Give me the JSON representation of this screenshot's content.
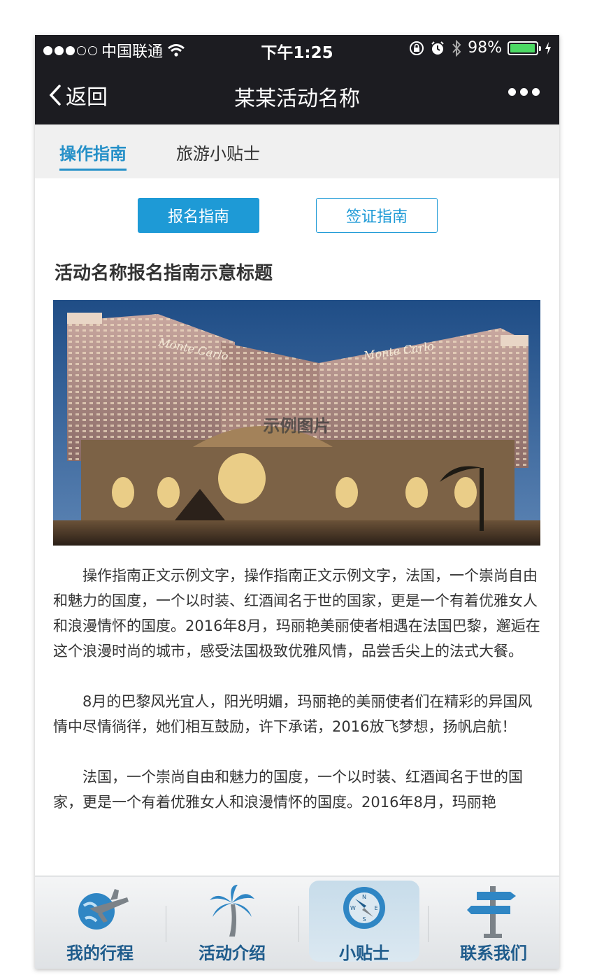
{
  "status_bar": {
    "carrier": "中国联通",
    "time": "下午1:25",
    "battery": "98%",
    "battery_level": 0.98,
    "signal_bars_filled": 3,
    "signal_bars_total": 5
  },
  "nav": {
    "back_label": "返回",
    "title": "某某活动名称"
  },
  "tabs": [
    {
      "label": "操作指南",
      "active": true
    },
    {
      "label": "旅游小贴士",
      "active": false
    }
  ],
  "sub_buttons": {
    "primary": "报名指南",
    "secondary": "签证指南"
  },
  "article": {
    "title": "活动名称报名指南示意标题",
    "image_caption": "示例图片",
    "hotel_sign": "Monte Carlo",
    "paragraphs": [
      "操作指南正文示例文字，操作指南正文示例文字，法国，一个崇尚自由和魅力的国度，一个以时装、红酒闻名于世的国家，更是一个有着优雅女人和浪漫情怀的国度。2016年8月，玛丽艳美丽使者相遇在法国巴黎，邂逅在这个浪漫时尚的城市，感受法国极致优雅风情，品尝舌尖上的法式大餐。",
      "8月的巴黎风光宜人，阳光明媚，玛丽艳的美丽使者们在精彩的异国风情中尽情徜徉，她们相互鼓励，许下承诺，2016放飞梦想，扬帆启航！",
      "法国，一个崇尚自由和魅力的国度，一个以时装、红酒闻名于世的国家，更是一个有着优雅女人和浪漫情怀的国度。2016年8月，玛丽艳"
    ]
  },
  "tabbar": [
    {
      "label": "我的行程",
      "icon": "globe-plane-icon",
      "active": false
    },
    {
      "label": "活动介绍",
      "icon": "palm-tree-icon",
      "active": false
    },
    {
      "label": "小贴士",
      "icon": "compass-icon",
      "active": true
    },
    {
      "label": "联系我们",
      "icon": "signpost-icon",
      "active": false
    }
  ],
  "colors": {
    "accent": "#1e9ad6",
    "bar_dark": "#1c1c21",
    "tab_label": "#1f5c8c"
  }
}
